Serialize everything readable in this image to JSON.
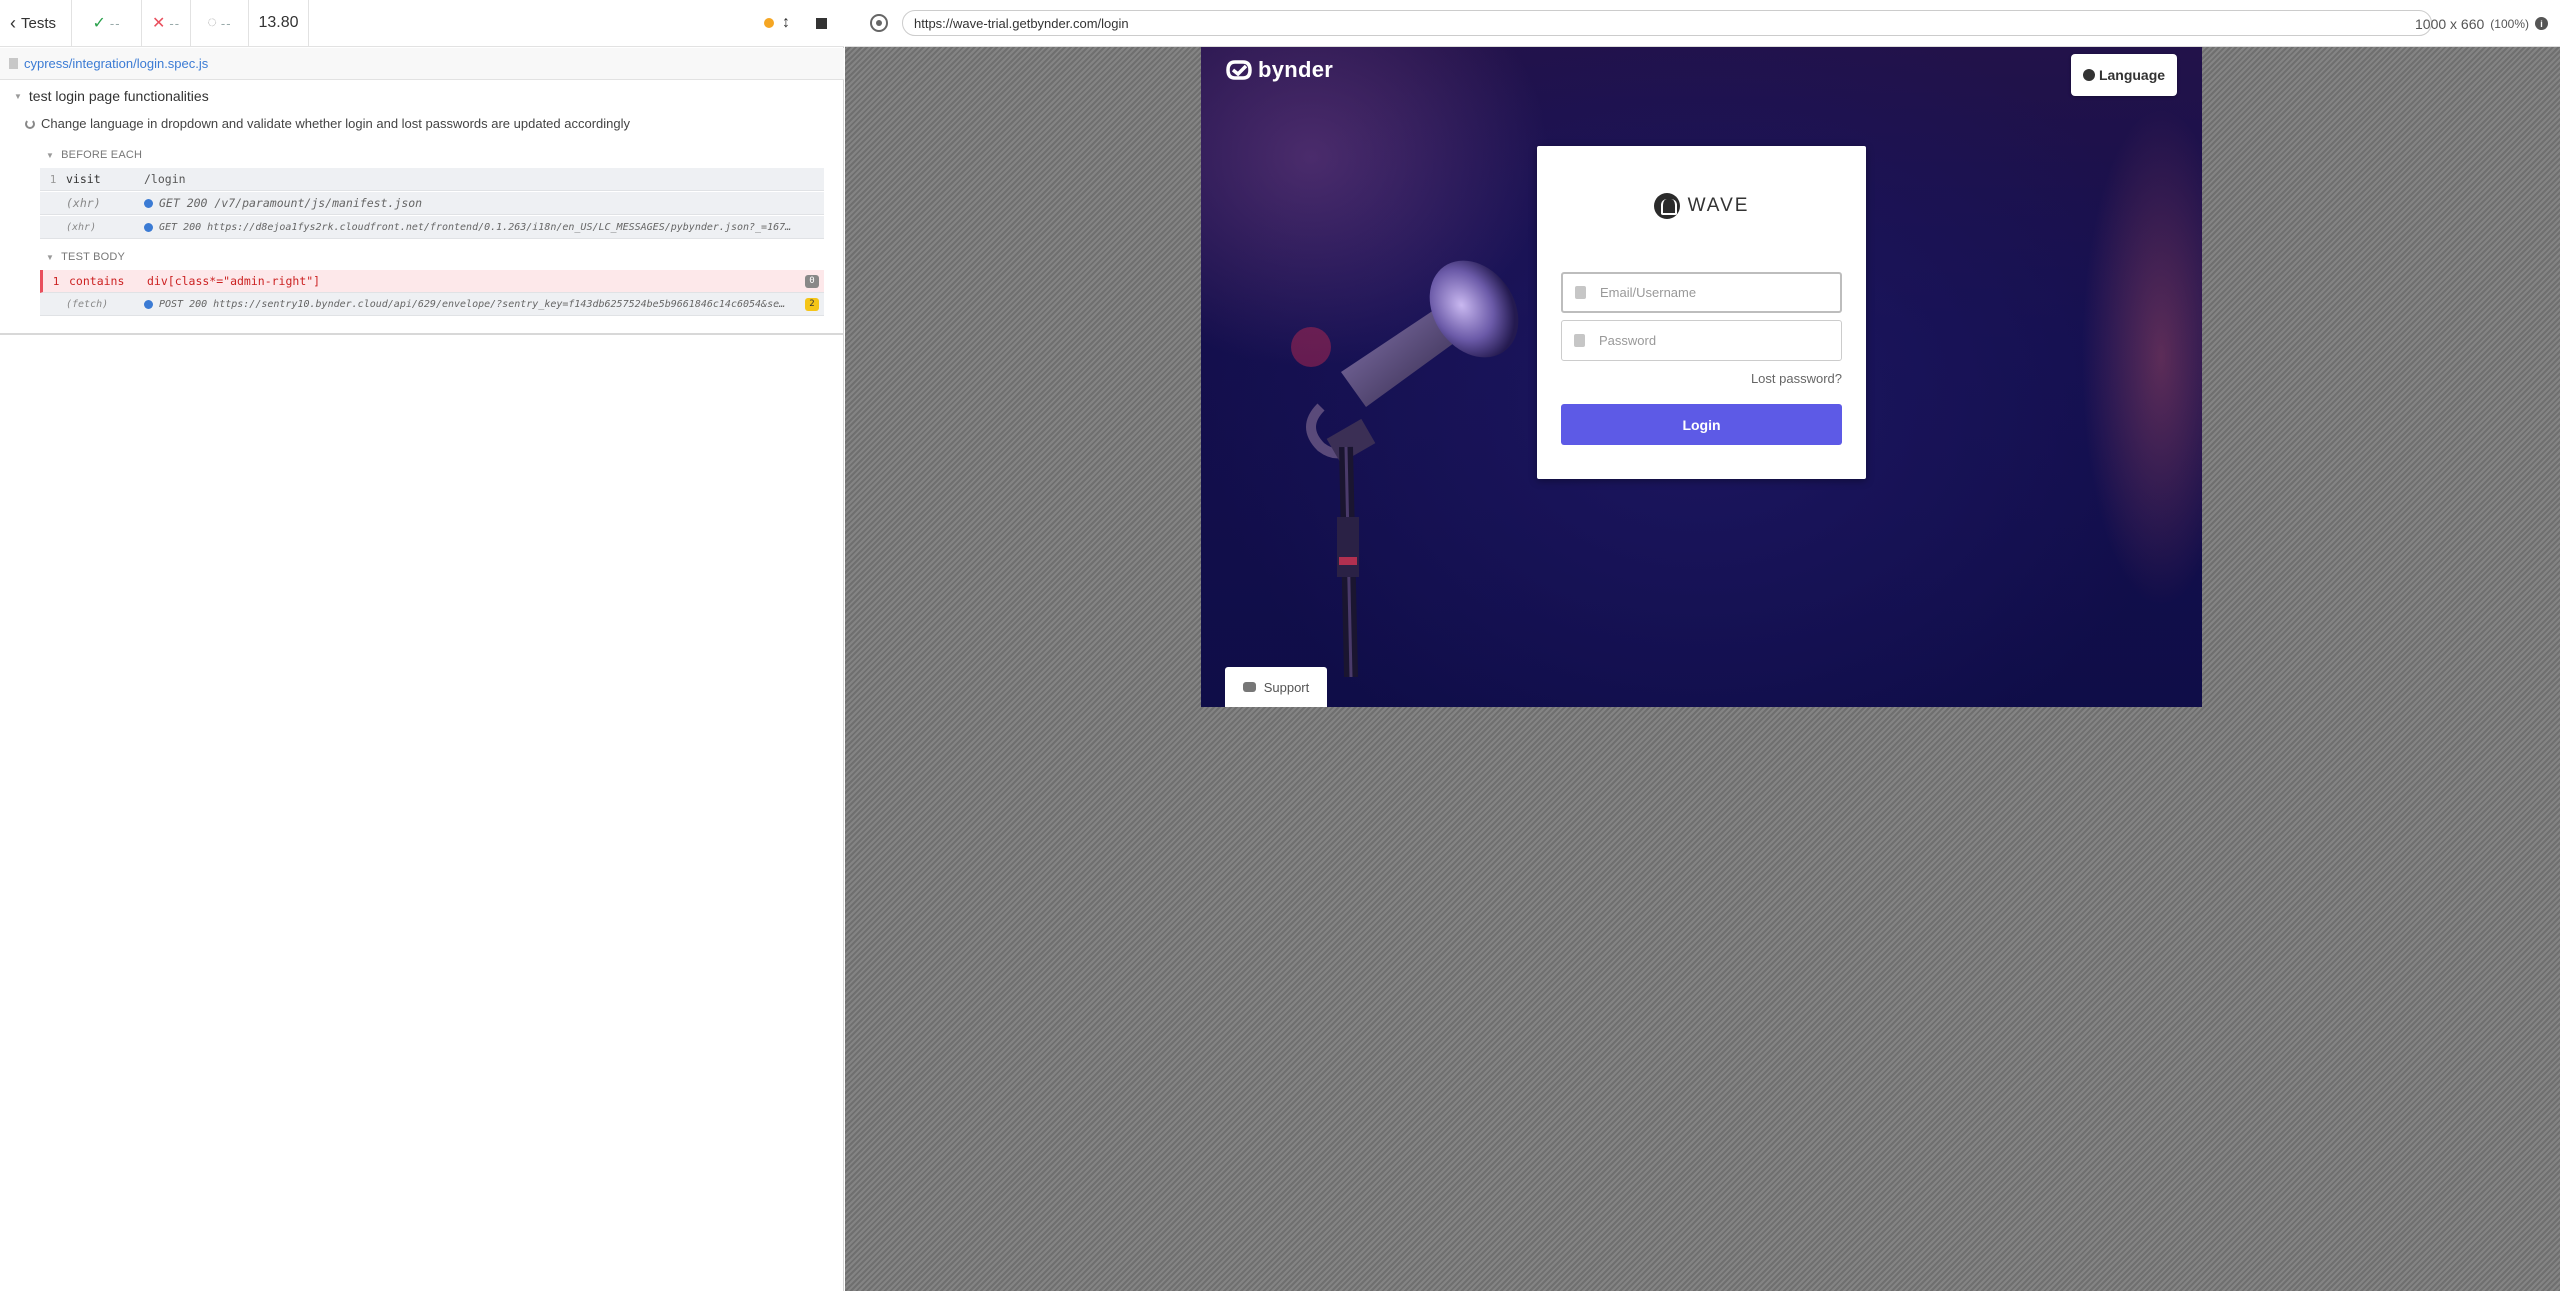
{
  "reporter": {
    "tests_label": "Tests",
    "passed": "--",
    "failed": "--",
    "pending": "--",
    "duration": "13.80",
    "spec_path": "cypress/integration/login.spec.js",
    "suite_title": "test login page functionalities",
    "test_title": "Change language in dropdown and validate whether login and lost passwords are updated accordingly",
    "before_each_label": "BEFORE EACH",
    "test_body_label": "TEST BODY",
    "commands": [
      {
        "num": "1",
        "name": "visit",
        "message": "/login"
      },
      {
        "num": "",
        "name": "(xhr)",
        "message": "GET 200 /v7/paramount/js/manifest.json"
      },
      {
        "num": "",
        "name": "(xhr)",
        "message": "GET 200 https://d8ejoa1fys2rk.cloudfront.net/frontend/0.1.263/i18n/en_US/LC_MESSAGES/pybynder.json?_=167…"
      },
      {
        "num": "1",
        "name": "contains",
        "message": "div[class*=\"admin-right\"]",
        "badge": "0"
      },
      {
        "num": "",
        "name": "(fetch)",
        "message": "POST 200 https://sentry10.bynder.cloud/api/629/envelope/?sentry_key=f143db6257524be5b9661846c14c6054&se…",
        "badge": "2"
      }
    ]
  },
  "browser": {
    "url": "https://wave-trial.getbynder.com/login",
    "viewport": "1000 x 660",
    "zoom": "(100%)"
  },
  "app": {
    "brand": "bynder",
    "language_button": "Language",
    "product": "WAVE",
    "email_placeholder": "Email/Username",
    "password_placeholder": "Password",
    "lost_password": "Lost password?",
    "login_button": "Login",
    "support_button": "Support"
  }
}
